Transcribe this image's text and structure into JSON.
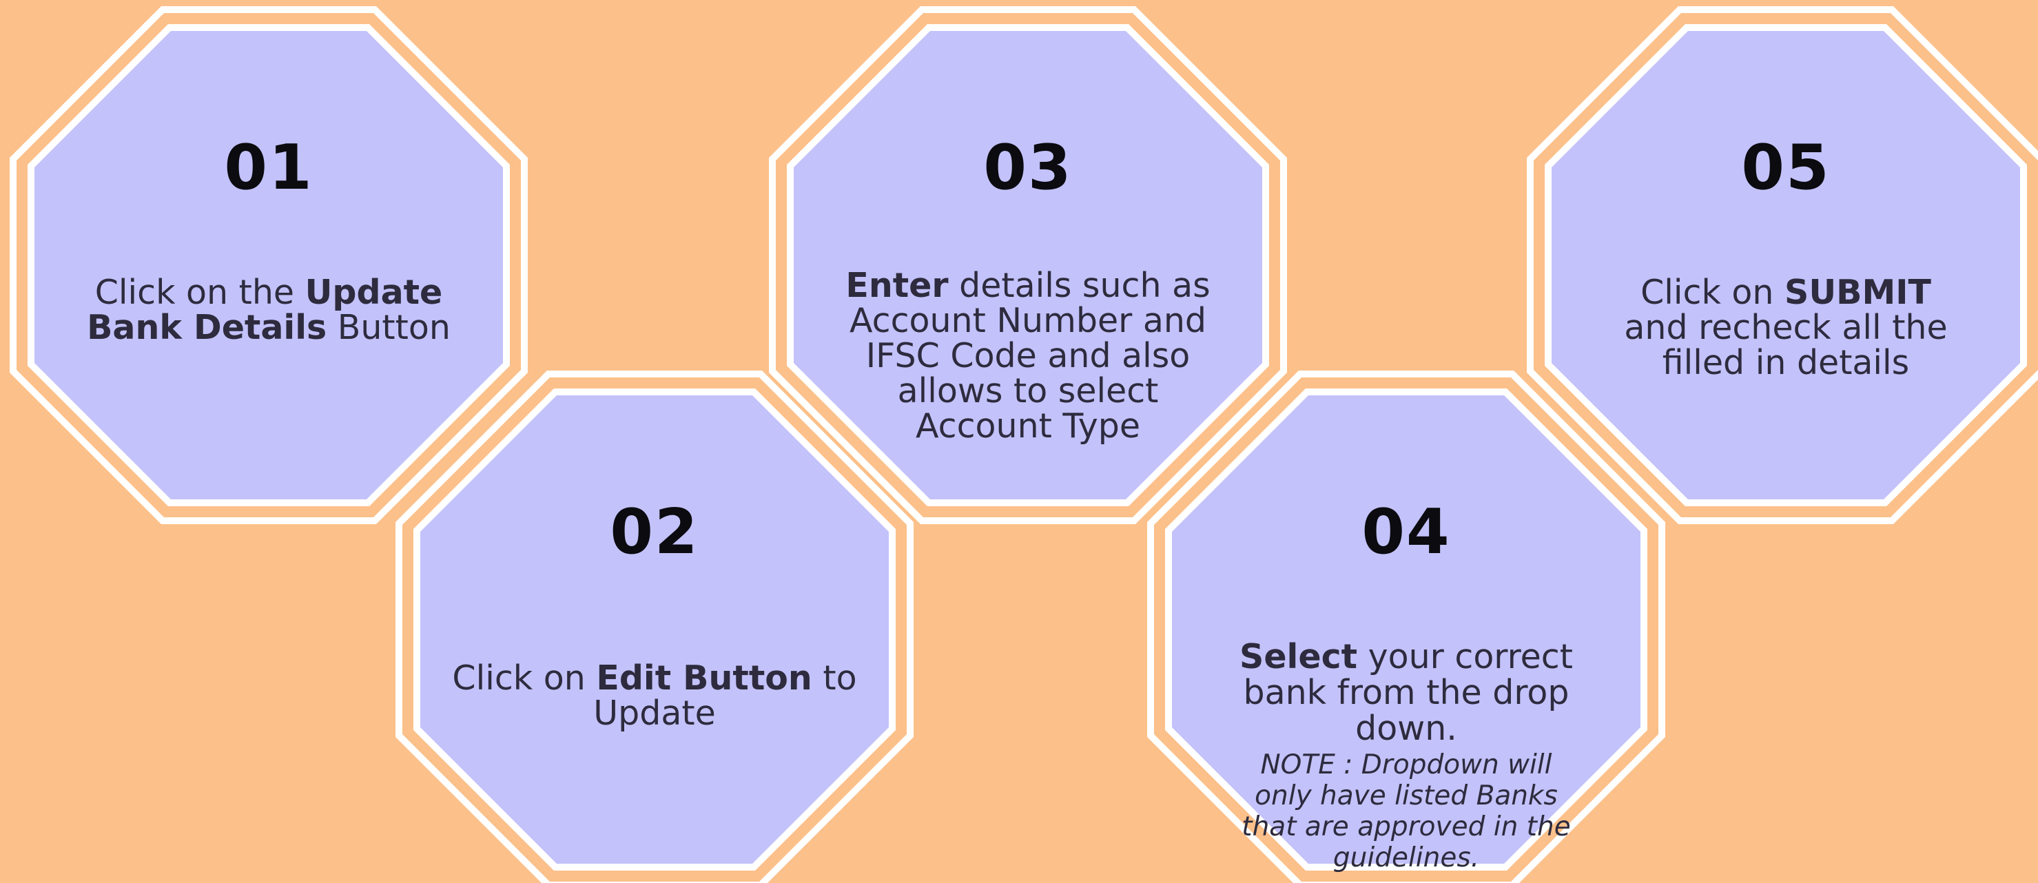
{
  "colors": {
    "background": "#fcc08a",
    "ring": "#ffffff",
    "fill": "#c3c2fa",
    "number": "#0b0b10",
    "text": "#2d2b3d"
  },
  "steps": [
    {
      "number": "01",
      "text_before": "Click on the ",
      "bold": "Update Bank Details",
      "text_after": " Button"
    },
    {
      "number": "02",
      "text_before": "Click on ",
      "bold": "Edit Button",
      "text_after": " to Update"
    },
    {
      "number": "03",
      "text_before": "",
      "bold": "Enter",
      "text_after": " details such as Account Number and IFSC Code and also allows to select Account Type"
    },
    {
      "number": "04",
      "text_before": "",
      "bold": "Select",
      "text_after": " your correct bank from the drop down.",
      "note": "NOTE : Dropdown will only have listed Banks that are approved in the guidelines."
    },
    {
      "number": "05",
      "text_before": "Click on ",
      "bold": "SUBMIT",
      "text_after": " and recheck all the filled in details"
    }
  ]
}
